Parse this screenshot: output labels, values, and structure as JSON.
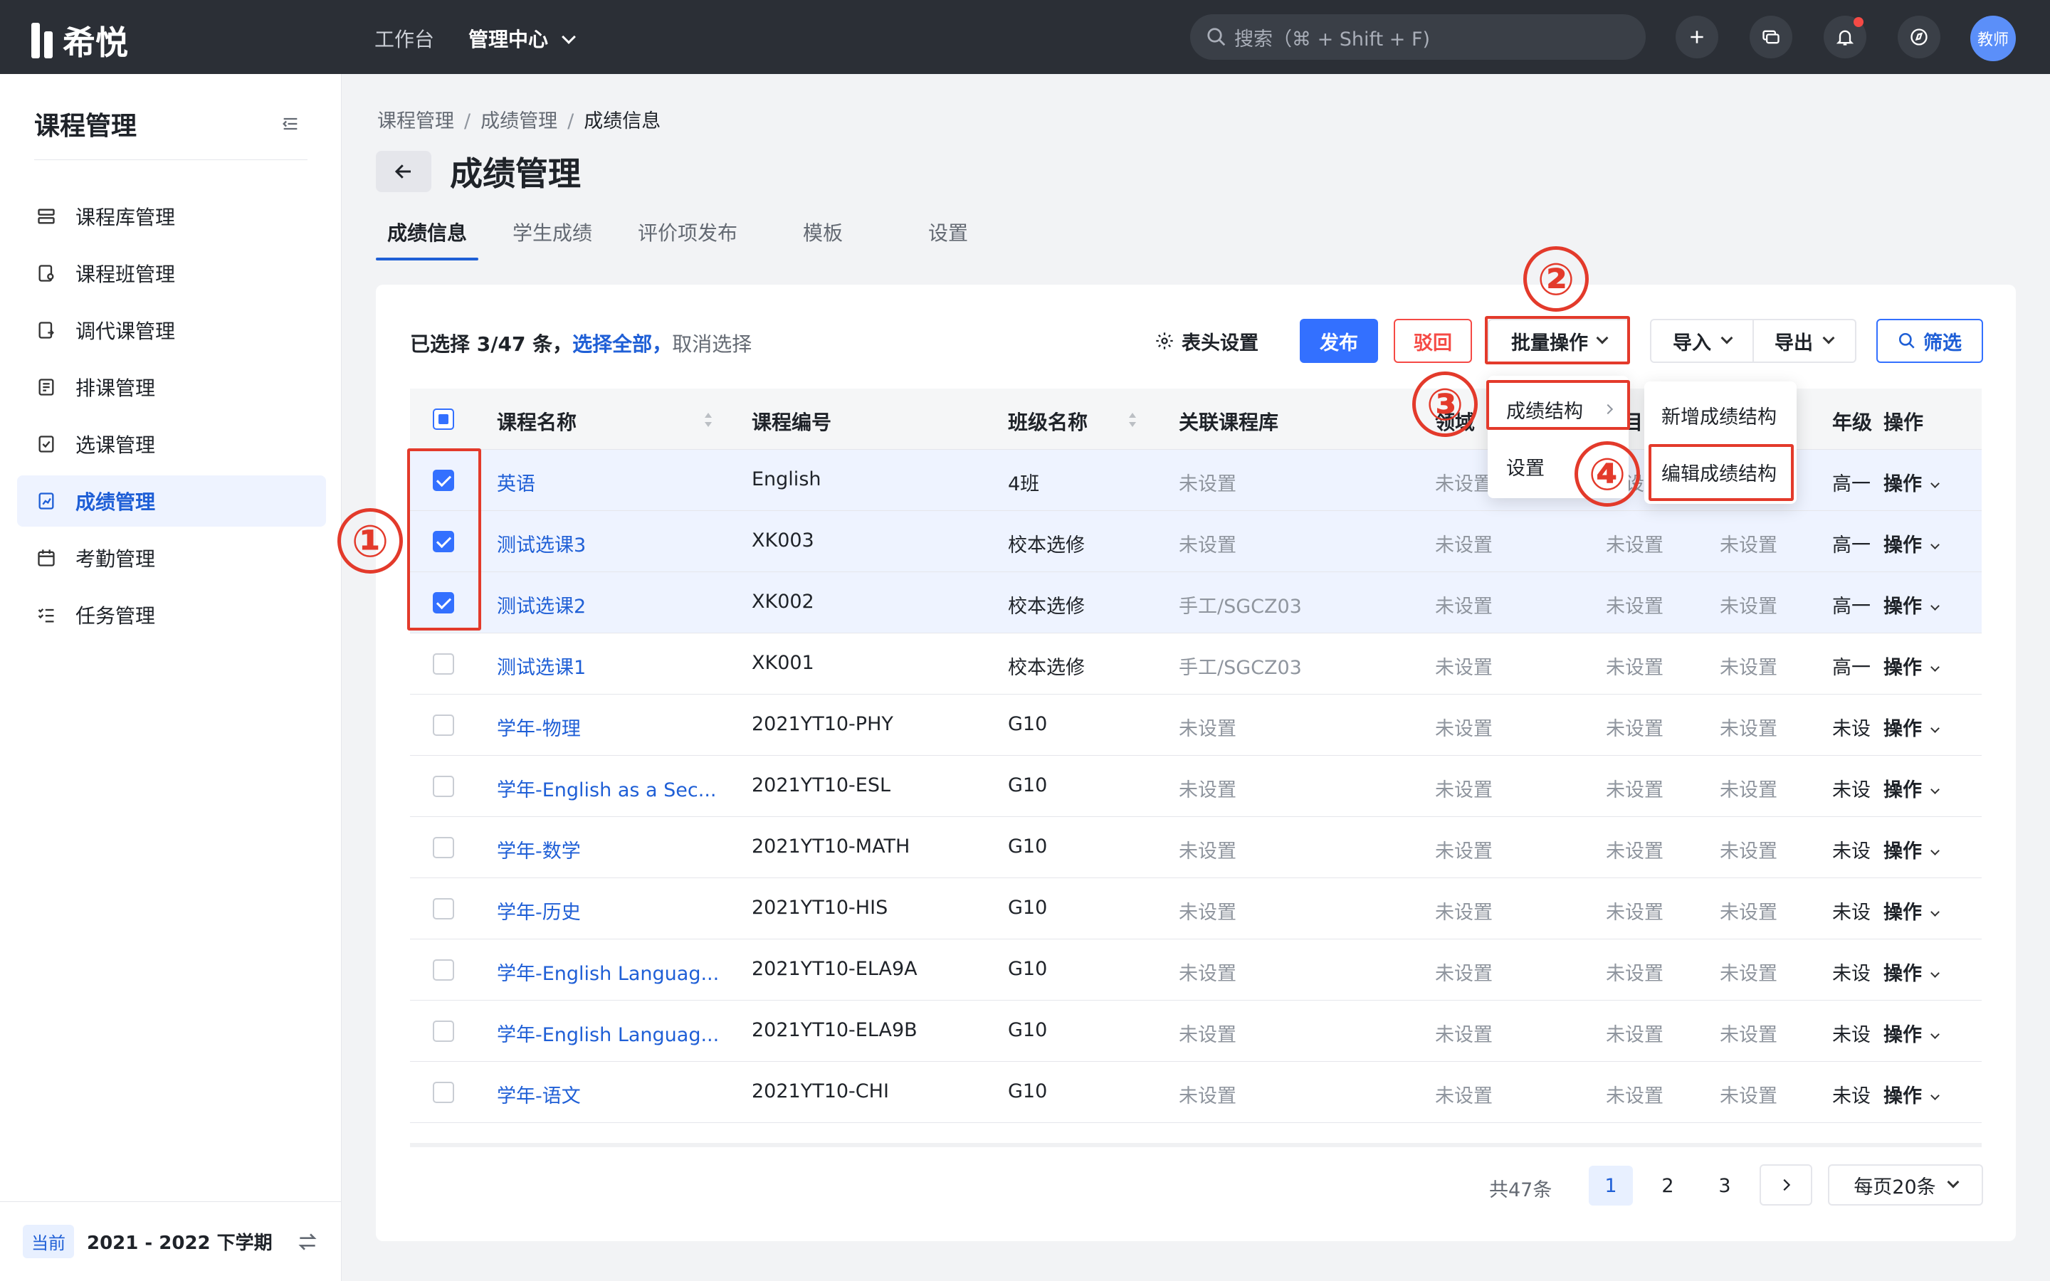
{
  "app": {
    "logo_text": "希悦",
    "nav": [
      "工作台",
      "管理中心"
    ],
    "search_placeholder": "搜索（⌘ + Shift + F)",
    "avatar_text": "教师"
  },
  "sidebar": {
    "title": "课程管理",
    "items": [
      {
        "label": "课程库管理",
        "icon": "stack-icon"
      },
      {
        "label": "课程班管理",
        "icon": "class-icon"
      },
      {
        "label": "调代课管理",
        "icon": "swap-doc-icon"
      },
      {
        "label": "排课管理",
        "icon": "schedule-icon"
      },
      {
        "label": "选课管理",
        "icon": "check-doc-icon"
      },
      {
        "label": "成绩管理",
        "icon": "grade-icon",
        "active": true
      },
      {
        "label": "考勤管理",
        "icon": "calendar-icon"
      },
      {
        "label": "任务管理",
        "icon": "task-list-icon"
      }
    ],
    "term_tag": "当前",
    "term": "2021 - 2022 下学期"
  },
  "breadcrumb": [
    "课程管理",
    "成绩管理",
    "成绩信息"
  ],
  "page_title": "成绩管理",
  "tabs": [
    "成绩信息",
    "学生成绩",
    "评价项发布",
    "模板",
    "设置"
  ],
  "toolbar": {
    "selection_prefix": "已选择 3/47 条，",
    "select_all": "选择全部，",
    "cancel_select": "取消选择",
    "header_settings": "表头设置",
    "publish": "发布",
    "reject": "驳回",
    "batch": "批量操作",
    "import": "导入",
    "export": "导出",
    "filter": "筛选"
  },
  "table": {
    "columns": [
      "课程名称",
      "课程编号",
      "班级名称",
      "关联课程库",
      "领域",
      "科目",
      "",
      "年级",
      "操作"
    ],
    "rows": [
      {
        "selected": true,
        "name": "英语",
        "code": "English",
        "class": "4班",
        "lib": "未设置",
        "c5": "未设置",
        "c6": "未设置",
        "c7": "未设置",
        "grade": "高一",
        "op": "操作"
      },
      {
        "selected": true,
        "name": "测试选课3",
        "code": "XK003",
        "class": "校本选修",
        "lib": "未设置",
        "c5": "未设置",
        "c6": "未设置",
        "c7": "未设置",
        "grade": "高一",
        "op": "操作"
      },
      {
        "selected": true,
        "name": "测试选课2",
        "code": "XK002",
        "class": "校本选修",
        "lib": "手工/SGCZ03",
        "c5": "未设置",
        "c6": "未设置",
        "c7": "未设置",
        "grade": "高一",
        "op": "操作"
      },
      {
        "selected": false,
        "name": "测试选课1",
        "code": "XK001",
        "class": "校本选修",
        "lib": "手工/SGCZ03",
        "c5": "未设置",
        "c6": "未设置",
        "c7": "未设置",
        "grade": "高一",
        "op": "操作"
      },
      {
        "selected": false,
        "name": "学年-物理",
        "code": "2021YT10-PHY",
        "class": "G10",
        "lib": "未设置",
        "c5": "未设置",
        "c6": "未设置",
        "c7": "未设置",
        "grade": "未设",
        "op": "操作"
      },
      {
        "selected": false,
        "name": "学年-English as a Sec...",
        "code": "2021YT10-ESL",
        "class": "G10",
        "lib": "未设置",
        "c5": "未设置",
        "c6": "未设置",
        "c7": "未设置",
        "grade": "未设",
        "op": "操作"
      },
      {
        "selected": false,
        "name": "学年-数学",
        "code": "2021YT10-MATH",
        "class": "G10",
        "lib": "未设置",
        "c5": "未设置",
        "c6": "未设置",
        "c7": "未设置",
        "grade": "未设",
        "op": "操作"
      },
      {
        "selected": false,
        "name": "学年-历史",
        "code": "2021YT10-HIS",
        "class": "G10",
        "lib": "未设置",
        "c5": "未设置",
        "c6": "未设置",
        "c7": "未设置",
        "grade": "未设",
        "op": "操作"
      },
      {
        "selected": false,
        "name": "学年-English Languag...",
        "code": "2021YT10-ELA9A",
        "class": "G10",
        "lib": "未设置",
        "c5": "未设置",
        "c6": "未设置",
        "c7": "未设置",
        "grade": "未设",
        "op": "操作"
      },
      {
        "selected": false,
        "name": "学年-English Languag...",
        "code": "2021YT10-ELA9B",
        "class": "G10",
        "lib": "未设置",
        "c5": "未设置",
        "c6": "未设置",
        "c7": "未设置",
        "grade": "未设",
        "op": "操作"
      },
      {
        "selected": false,
        "name": "学年-语文",
        "code": "2021YT10-CHI",
        "class": "G10",
        "lib": "未设置",
        "c5": "未设置",
        "c6": "未设置",
        "c7": "未设置",
        "grade": "未设",
        "op": "操作"
      }
    ]
  },
  "batch_menu": {
    "items": [
      "成绩结构",
      "设置"
    ],
    "submenu": [
      "新增成绩结构",
      "编辑成绩结构"
    ]
  },
  "annotations": [
    "①",
    "②",
    "③",
    "④"
  ],
  "pagination": {
    "total": "共47条",
    "pages": [
      "1",
      "2",
      "3"
    ],
    "page_size": "每页20条"
  },
  "colors": {
    "accent": "#3370ff",
    "danger": "#f54a45",
    "annotation": "#e33a2b",
    "topbar": "#2b2f36"
  }
}
